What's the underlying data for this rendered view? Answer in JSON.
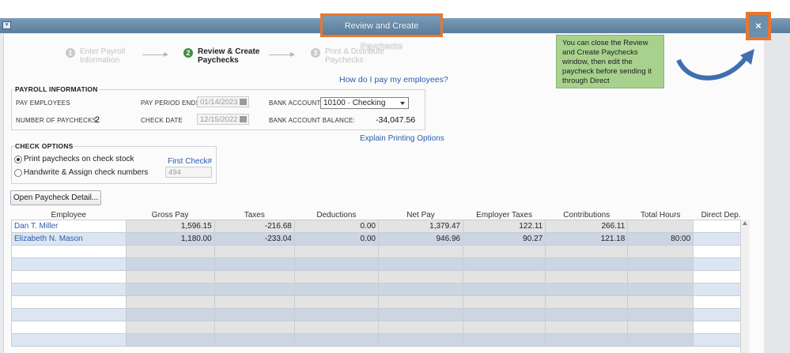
{
  "window": {
    "title": "Review and Create Paychecks",
    "close_label": "×",
    "menu_glyph": "▾"
  },
  "steps": [
    {
      "num": "1",
      "label": "Enter Payroll\nInformation"
    },
    {
      "num": "2",
      "label": "Review & Create\nPaychecks"
    },
    {
      "num": "3",
      "label": "Print & Distribute\nPaychecks"
    }
  ],
  "callout": {
    "text": "You can close the Review and Create Paychecks window, then edit the paycheck before sending it through Direct"
  },
  "help_link": "How do I pay my employees?",
  "payroll_info": {
    "heading": "PAYROLL INFORMATION",
    "pay_employees_label": "PAY EMPLOYEES",
    "num_paychecks_label": "NUMBER OF PAYCHECKS:",
    "num_paychecks": "2",
    "period_ends_label": "PAY PERIOD ENDS",
    "period_ends": "01/14/2023",
    "check_date_label": "CHECK DATE",
    "check_date": "12/15/2022",
    "bank_account_label": "BANK ACCOUNT",
    "bank_account": "10100 · Checking",
    "balance_label": "BANK ACCOUNT BALANCE:",
    "balance": "-34,047.56"
  },
  "printing_link": "Explain Printing Options",
  "check_options": {
    "heading": "CHECK OPTIONS",
    "opt_print": "Print paychecks on check stock",
    "opt_handwrite": "Handwrite & Assign check numbers",
    "first_check_label": "First Check#",
    "first_check": "494"
  },
  "open_detail_button": "Open Paycheck Detail...",
  "table": {
    "headers": [
      "Employee",
      "Gross Pay",
      "Taxes",
      "Deductions",
      "Net Pay",
      "Employer Taxes",
      "Contributions",
      "Total Hours",
      "Direct Dep."
    ],
    "rows": [
      [
        "Dan T. Miller",
        "1,596.15",
        "-216.68",
        "0.00",
        "1,379.47",
        "122.11",
        "266.11",
        "",
        ""
      ],
      [
        "Elizabeth N. Mason",
        "1,180.00",
        "-233.04",
        "0.00",
        "946.96",
        "90.27",
        "121.18",
        "80:00",
        ""
      ]
    ]
  },
  "colors": {
    "accent_orange": "#e8772e",
    "callout_green": "#a9d18e",
    "arrow_blue": "#3f6fb0"
  },
  "icons": {
    "calendar": "calendar-icon",
    "close": "close-icon",
    "scroll_up": "scroll-up-icon"
  }
}
